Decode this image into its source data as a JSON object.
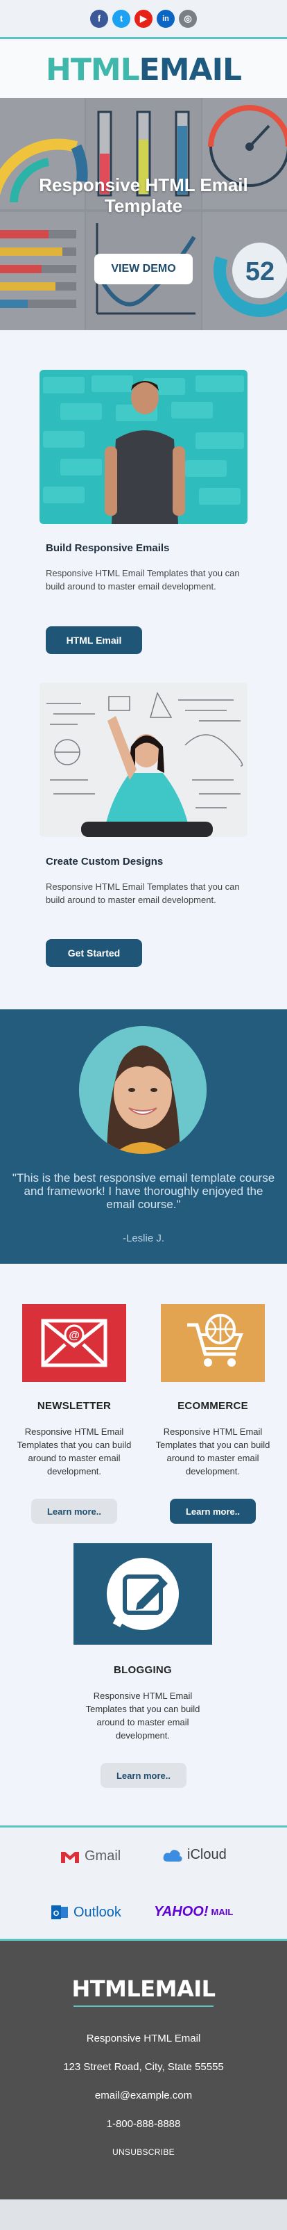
{
  "social": {
    "icons": [
      "facebook-icon",
      "twitter-icon",
      "youtube-icon",
      "linkedin-icon",
      "instagram-icon"
    ],
    "glyphs": {
      "facebook": "f",
      "twitter": "t",
      "youtube": "▶",
      "linkedin": "in",
      "instagram": "◎"
    }
  },
  "logo": {
    "part1": "HTML",
    "part2": "EMAIL"
  },
  "hero": {
    "title": "Responsive HTML Email Template",
    "button": "VIEW DEMO",
    "gauge_value": "52"
  },
  "cards": [
    {
      "title": "Build Responsive Emails",
      "text": "Responsive HTML Email Templates that you can build around to master email development.",
      "button": "HTML Email"
    },
    {
      "title": "Create Custom Designs",
      "text": "Responsive HTML Email Templates that you can build around to master email development.",
      "button": "Get Started"
    }
  ],
  "testimonial": {
    "quote": "\"This is the best responsive email template course and framework! I have thoroughly enjoyed the email course.\"",
    "author": "-Leslie J."
  },
  "features": [
    {
      "title": "NEWSLETTER",
      "text": "Responsive HTML Email Templates that you can build around to master email development.",
      "button": "Learn more..",
      "icon": "email-icon",
      "color": "#d9303a"
    },
    {
      "title": "ECOMMERCE",
      "text": "Responsive HTML Email Templates that you can build around to master email development.",
      "button": "Learn more..",
      "icon": "shopping-cart-icon",
      "color": "#e3a452"
    },
    {
      "title": "BLOGGING",
      "text": "Responsive HTML Email Templates that you can build around to master email development.",
      "button": "Learn more..",
      "icon": "edit-icon",
      "color": "#245c7e"
    }
  ],
  "clients": {
    "gmail": "Gmail",
    "icloud": "iCloud",
    "outlook": "Outlook",
    "yahoo": "YAHOO!",
    "yahoo_mail": "MAIL"
  },
  "footer": {
    "logo": "HTMLEMAIL",
    "company": "Responsive HTML Email",
    "address": "123 Street Road, City, State 55555",
    "email": "email@example.com",
    "phone": "1-800-888-8888",
    "unsubscribe": "UNSUBSCRIBE"
  },
  "colors": {
    "accent": "#5cc2c2",
    "brand_dark": "#1f5576",
    "brand_teal": "#3fb7aa",
    "footer_bg": "#505050"
  }
}
